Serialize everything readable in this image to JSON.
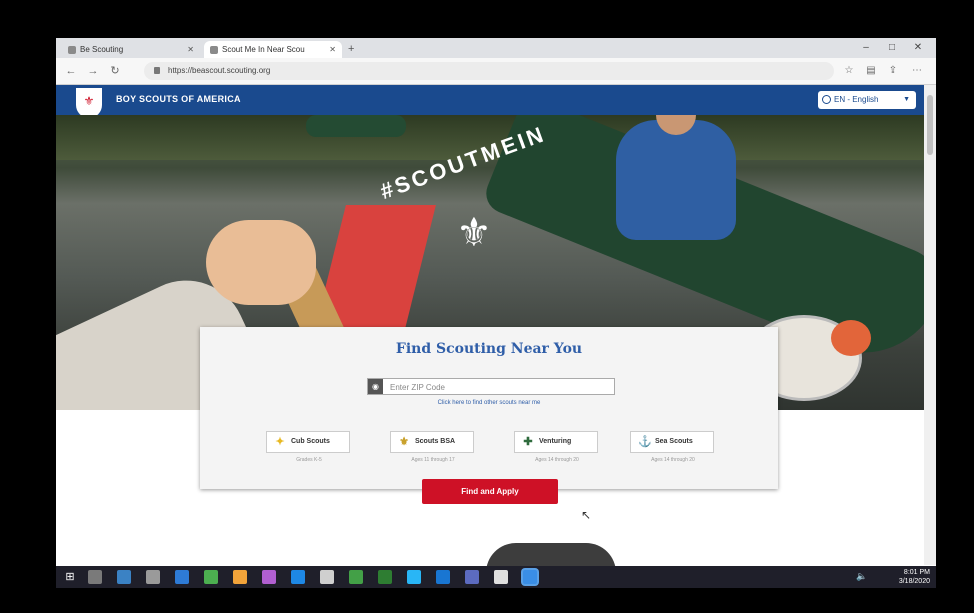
{
  "browser": {
    "tabs": [
      {
        "title": "Be Scouting",
        "active": false
      },
      {
        "title": "Scout Me In Near Scou",
        "active": true
      }
    ],
    "new_tab_label": "+",
    "window_controls": [
      "–",
      "□",
      "✕"
    ],
    "url": "https://beascout.scouting.org"
  },
  "site": {
    "name": "BOY SCOUTS OF AMERICA",
    "logo_glyph": "⚜",
    "language_label": "EN - English"
  },
  "hero": {
    "tagline": "#SCOUTMEIN"
  },
  "finder": {
    "heading": "Find Scouting Near You",
    "zip_placeholder": "Enter ZIP Code",
    "help_link": "Click here to find other scouts near me",
    "programs": [
      {
        "label": "Cub Scouts",
        "sub": "Grades K-5",
        "color": "#e8b923",
        "glyph": "✦"
      },
      {
        "label": "Scouts BSA",
        "sub": "Ages 11 through 17",
        "color": "#c8a02a",
        "glyph": "⚜"
      },
      {
        "label": "Venturing",
        "sub": "Ages 14 through 20",
        "color": "#2f6b3d",
        "glyph": "✚"
      },
      {
        "label": "Sea Scouts",
        "sub": "Ages 14 through 20",
        "color": "#777777",
        "glyph": "⚓"
      }
    ],
    "cta_label": "Find and Apply"
  },
  "taskbar": {
    "time": "8:01 PM",
    "date": "3/18/2020",
    "app_colors": [
      "#7a7a7a",
      "#3b82c4",
      "#9a9a9a",
      "#2e7bd6",
      "#4caf50",
      "#f2a33a",
      "#b15fd1",
      "#1e88e5",
      "#cfcfcf",
      "#43a047",
      "#2e7d32",
      "#29b6f6",
      "#1976d2",
      "#5c6bc0",
      "#e0e0e0",
      "#3a8ee6"
    ]
  }
}
